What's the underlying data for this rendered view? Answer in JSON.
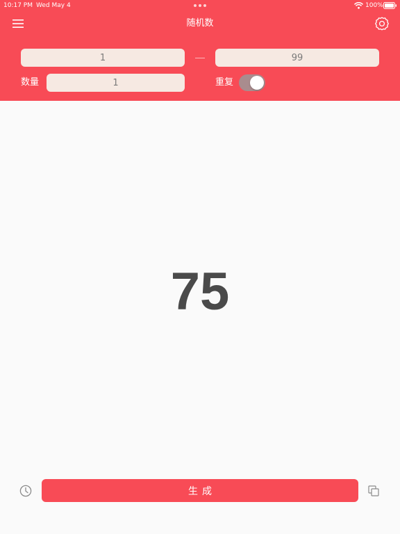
{
  "status_bar": {
    "time": "10:17 PM",
    "date": "Wed May 4",
    "battery": "100%"
  },
  "header": {
    "title": "随机数",
    "menu_icon": "hamburger-menu-icon",
    "settings_icon": "gear-icon"
  },
  "range": {
    "min": "1",
    "max": "99"
  },
  "options": {
    "count_label": "数量",
    "count_value": "1",
    "repeat_label": "重复",
    "repeat_enabled": true
  },
  "result": {
    "value": "75"
  },
  "footer": {
    "generate_label": "生成",
    "history_icon": "clock-icon",
    "copy_icon": "copy-icon"
  },
  "colors": {
    "accent": "#f84b56",
    "input_background": "#f6e9e2",
    "toggle_on": "#a98c8e",
    "result_text": "#4a4a4a",
    "page_background": "#fafafa"
  }
}
